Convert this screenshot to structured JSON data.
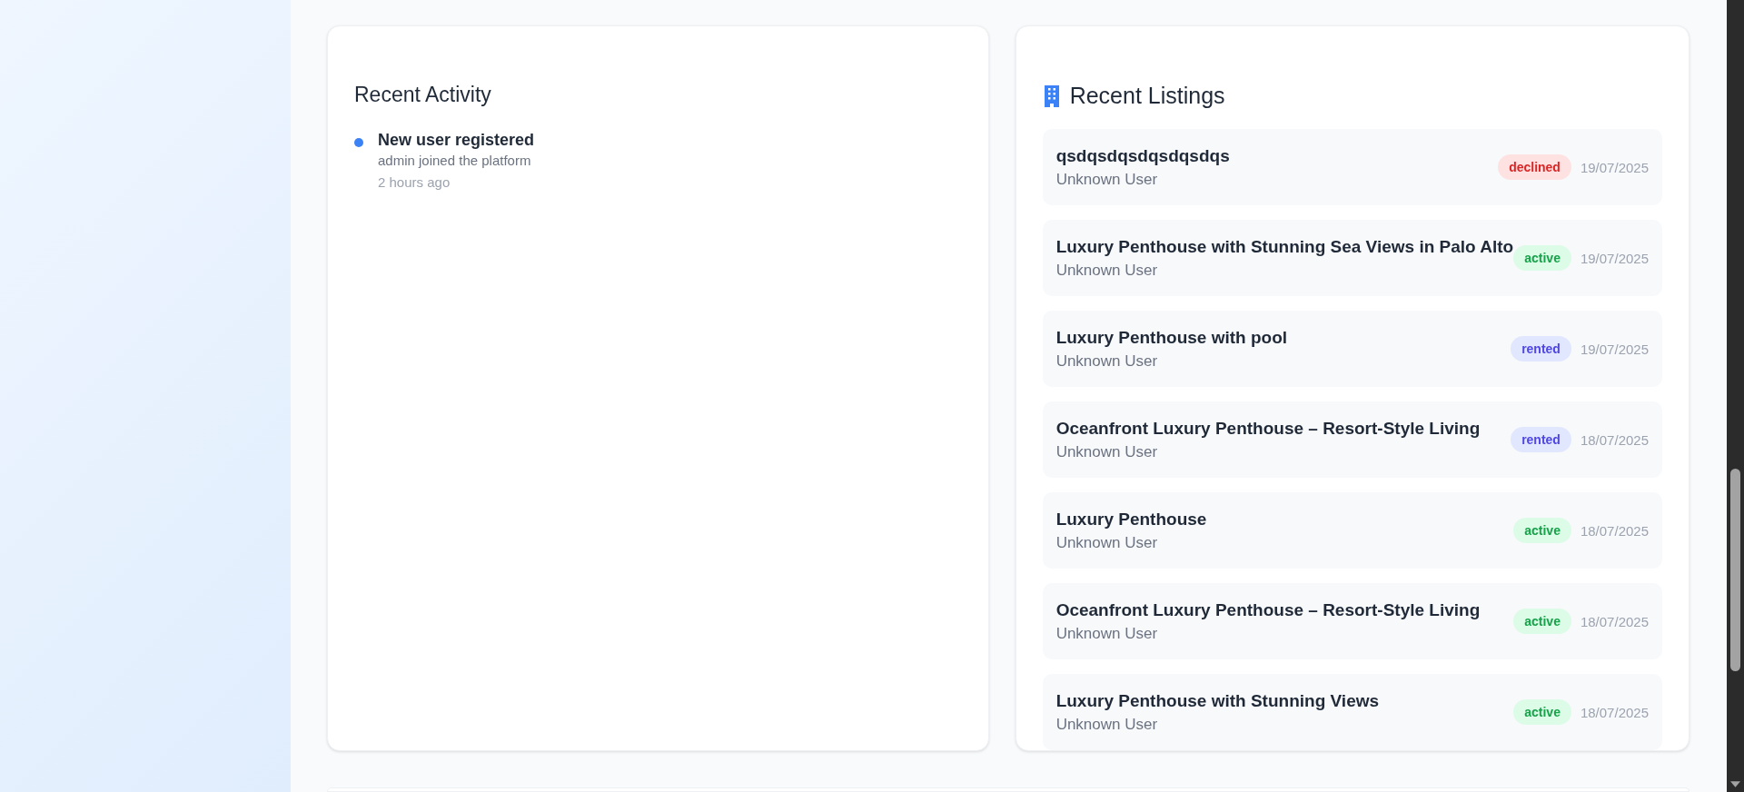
{
  "recent_activity": {
    "title": "Recent Activity",
    "items": [
      {
        "title": "New user registered",
        "detail": "admin joined the platform",
        "time": "2 hours ago"
      }
    ]
  },
  "recent_listings": {
    "title": "Recent Listings",
    "items": [
      {
        "title": "qsdqsdqsdqsdqsdqs",
        "owner": "Unknown User",
        "status": "declined",
        "kind": "declined",
        "date": "19/07/2025"
      },
      {
        "title": "Luxury Penthouse with Stunning Sea Views in Palo Alto",
        "owner": "Unknown User",
        "status": "active",
        "kind": "active",
        "date": "19/07/2025"
      },
      {
        "title": "Luxury Penthouse with pool",
        "owner": "Unknown User",
        "status": "rented",
        "kind": "rented",
        "date": "19/07/2025"
      },
      {
        "title": "Oceanfront Luxury Penthouse – Resort-Style Living",
        "owner": "Unknown User",
        "status": "rented",
        "kind": "rented",
        "date": "18/07/2025"
      },
      {
        "title": "Luxury Penthouse",
        "owner": "Unknown User",
        "status": "active",
        "kind": "active",
        "date": "18/07/2025"
      },
      {
        "title": "Oceanfront Luxury Penthouse – Resort-Style Living",
        "owner": "Unknown User",
        "status": "active",
        "kind": "active",
        "date": "18/07/2025"
      },
      {
        "title": "Luxury Penthouse with Stunning Views",
        "owner": "Unknown User",
        "status": "active",
        "kind": "active",
        "date": "18/07/2025"
      }
    ]
  }
}
